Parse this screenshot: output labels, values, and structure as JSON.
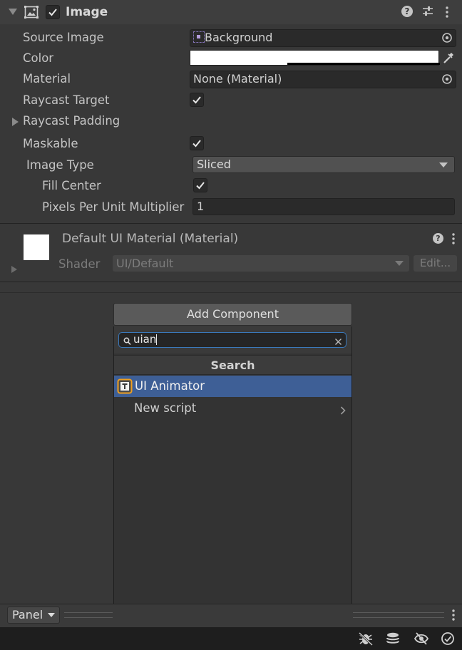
{
  "component": {
    "title": "Image",
    "enabled": true,
    "fields": {
      "source_image_label": "Source Image",
      "source_image_value": "Background",
      "color_label": "Color",
      "material_label": "Material",
      "material_value": "None (Material)",
      "raycast_target_label": "Raycast Target",
      "raycast_target_checked": true,
      "raycast_padding_label": "Raycast Padding",
      "maskable_label": "Maskable",
      "maskable_checked": true,
      "image_type_label": "Image Type",
      "image_type_value": "Sliced",
      "fill_center_label": "Fill Center",
      "fill_center_checked": true,
      "ppu_label": "Pixels Per Unit Multiplier",
      "ppu_value": "1"
    }
  },
  "material_section": {
    "title": "Default UI Material (Material)",
    "shader_label": "Shader",
    "shader_value": "UI/Default",
    "edit_label": "Edit..."
  },
  "add_component": {
    "button_label": "Add Component",
    "search_value": "uian",
    "results_header": "Search",
    "results": [
      {
        "label": "UI Animator",
        "selected": true
      },
      {
        "label": "New script",
        "has_submenu": true
      }
    ]
  },
  "bottom_panel": {
    "dropdown_label": "Panel"
  },
  "colors": {
    "selection": "#3e5f96",
    "focus_border": "#3a79bb",
    "panel_bg": "#383838",
    "field_bg": "#2a2a2a"
  }
}
